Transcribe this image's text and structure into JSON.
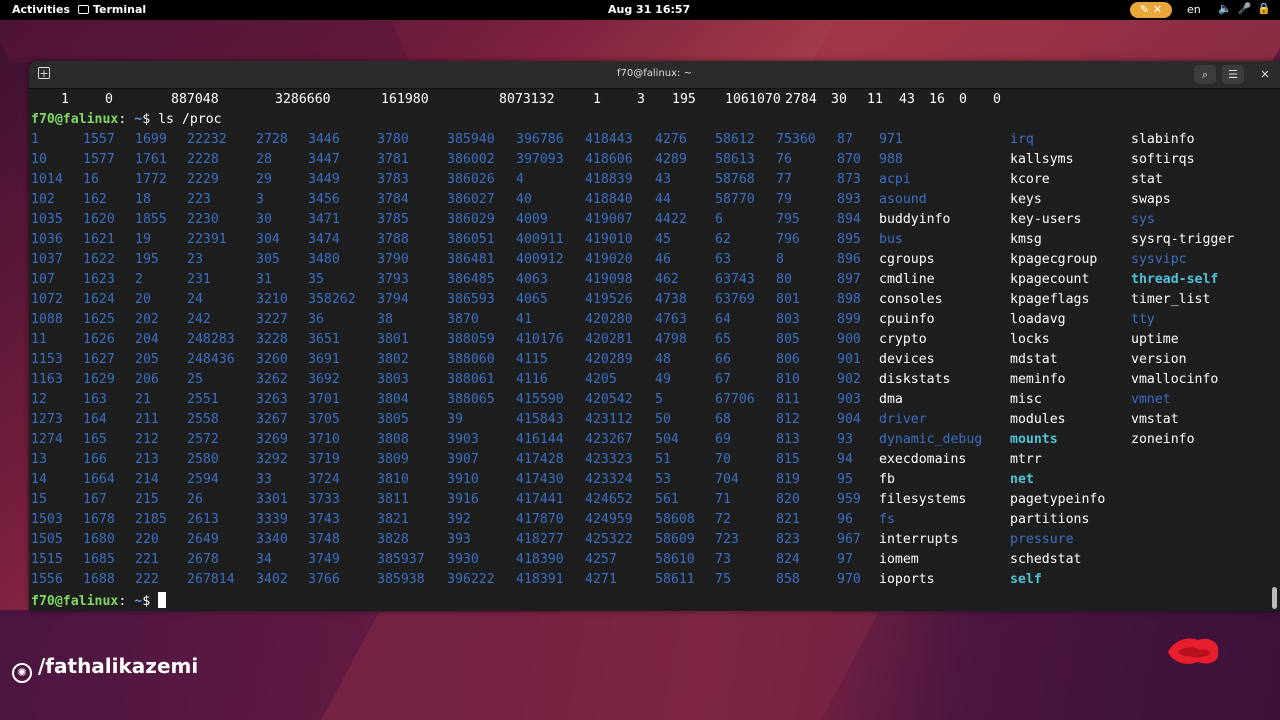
{
  "topbar": {
    "activities": "Activities",
    "app_name": "Terminal",
    "clock": "Aug 31  16:57",
    "indicator": "✎ ✕",
    "lang": "en",
    "tray": "🔈🎤🔒"
  },
  "window": {
    "title": "f70@falinux: ~"
  },
  "terminal": {
    "prev_line": [
      "1",
      "0",
      "887048",
      "3286660",
      "161980",
      "8073132",
      "1",
      "3",
      "195",
      "106",
      "1070",
      "2784",
      "30",
      "11",
      "43",
      "16",
      "0",
      "0"
    ],
    "prompt_user": "f70@falinux",
    "prompt_sep": ":",
    "prompt_path": " ~",
    "prompt_dollar": "$ ",
    "command": "ls /proc",
    "columns": [
      {
        "type": "dir",
        "items": [
          "1",
          "10",
          "1014",
          "102",
          "1035",
          "1036",
          "1037",
          "107",
          "1072",
          "1088",
          "11",
          "1153",
          "1163",
          "12",
          "1273",
          "1274",
          "13",
          "14",
          "15",
          "1503",
          "1505",
          "1515",
          "1556"
        ]
      },
      {
        "type": "dir",
        "items": [
          "1557",
          "1577",
          "16",
          "162",
          "1620",
          "1621",
          "1622",
          "1623",
          "1624",
          "1625",
          "1626",
          "1627",
          "1629",
          "163",
          "164",
          "165",
          "166",
          "1664",
          "167",
          "1678",
          "1680",
          "1685",
          "1688"
        ]
      },
      {
        "type": "dir",
        "items": [
          "1699",
          "1761",
          "1772",
          "18",
          "1855",
          "19",
          "195",
          "2",
          "20",
          "202",
          "204",
          "205",
          "206",
          "21",
          "211",
          "212",
          "213",
          "214",
          "215",
          "2185",
          "220",
          "221",
          "222"
        ]
      },
      {
        "type": "dir",
        "items": [
          "22232",
          "2228",
          "2229",
          "223",
          "2230",
          "22391",
          "23",
          "231",
          "24",
          "242",
          "248283",
          "248436",
          "25",
          "2551",
          "2558",
          "2572",
          "2580",
          "2594",
          "26",
          "2613",
          "2649",
          "2678",
          "267814"
        ]
      },
      {
        "type": "dir",
        "items": [
          "2728",
          "28",
          "29",
          "3",
          "30",
          "304",
          "305",
          "31",
          "3210",
          "3227",
          "3228",
          "3260",
          "3262",
          "3263",
          "3267",
          "3269",
          "3292",
          "33",
          "3301",
          "3339",
          "3340",
          "34",
          "3402"
        ]
      },
      {
        "type": "dir",
        "items": [
          "3446",
          "3447",
          "3449",
          "3456",
          "3471",
          "3474",
          "3480",
          "35",
          "358262",
          "36",
          "3651",
          "3691",
          "3692",
          "3701",
          "3705",
          "3710",
          "3719",
          "3724",
          "3733",
          "3743",
          "3748",
          "3749",
          "3766"
        ]
      },
      {
        "type": "dir",
        "items": [
          "3780",
          "3781",
          "3783",
          "3784",
          "3785",
          "3788",
          "3790",
          "3793",
          "3794",
          "38",
          "3801",
          "3802",
          "3803",
          "3804",
          "3805",
          "3808",
          "3809",
          "3810",
          "3811",
          "3821",
          "3828",
          "385937",
          "385938"
        ]
      },
      {
        "type": "dir",
        "items": [
          "385940",
          "386002",
          "386026",
          "386027",
          "386029",
          "386051",
          "386481",
          "386485",
          "386593",
          "3870",
          "388059",
          "388060",
          "388061",
          "388065",
          "39",
          "3903",
          "3907",
          "3910",
          "3916",
          "392",
          "393",
          "3930",
          "396222"
        ]
      },
      {
        "type": "dir",
        "items": [
          "396786",
          "397093",
          "4",
          "40",
          "4009",
          "400911",
          "400912",
          "4063",
          "4065",
          "41",
          "410176",
          "4115",
          "4116",
          "415590",
          "415843",
          "416144",
          "417428",
          "417430",
          "417441",
          "417870",
          "418277",
          "418390",
          "418391"
        ]
      },
      {
        "type": "dir",
        "items": [
          "418443",
          "418606",
          "418839",
          "418840",
          "419007",
          "419010",
          "419020",
          "419098",
          "419526",
          "420280",
          "420281",
          "420289",
          "4205",
          "420542",
          "423112",
          "423267",
          "423323",
          "423324",
          "424652",
          "424959",
          "425322",
          "4257",
          "4271"
        ]
      },
      {
        "type": "dir",
        "items": [
          "4276",
          "4289",
          "43",
          "44",
          "4422",
          "45",
          "46",
          "462",
          "4738",
          "4763",
          "4798",
          "48",
          "49",
          "5",
          "50",
          "504",
          "51",
          "53",
          "561",
          "58608",
          "58609",
          "58610",
          "58611"
        ]
      },
      {
        "type": "dir",
        "items": [
          "58612",
          "58613",
          "58768",
          "58770",
          "6",
          "62",
          "63",
          "63743",
          "63769",
          "64",
          "65",
          "66",
          "67",
          "67706",
          "68",
          "69",
          "70",
          "704",
          "71",
          "72",
          "723",
          "73",
          "75"
        ]
      },
      {
        "type": "dir",
        "items": [
          "75360",
          "76",
          "77",
          "79",
          "795",
          "796",
          "8",
          "80",
          "801",
          "803",
          "805",
          "806",
          "810",
          "811",
          "812",
          "813",
          "815",
          "819",
          "820",
          "821",
          "823",
          "824",
          "858"
        ]
      },
      {
        "type": "dir",
        "items": [
          "87",
          "870",
          "873",
          "893",
          "894",
          "895",
          "896",
          "897",
          "898",
          "899",
          "900",
          "901",
          "902",
          "903",
          "904",
          "93",
          "94",
          "95",
          "959",
          "96",
          "967",
          "97",
          "970"
        ]
      },
      {
        "type": "mixed",
        "items": [
          {
            "t": "dir",
            "v": "971"
          },
          {
            "t": "dir",
            "v": "988"
          },
          {
            "t": "dir",
            "v": "acpi"
          },
          {
            "t": "dir",
            "v": "asound"
          },
          {
            "t": "reg",
            "v": "buddyinfo"
          },
          {
            "t": "dir",
            "v": "bus"
          },
          {
            "t": "reg",
            "v": "cgroups"
          },
          {
            "t": "reg",
            "v": "cmdline"
          },
          {
            "t": "reg",
            "v": "consoles"
          },
          {
            "t": "reg",
            "v": "cpuinfo"
          },
          {
            "t": "reg",
            "v": "crypto"
          },
          {
            "t": "reg",
            "v": "devices"
          },
          {
            "t": "reg",
            "v": "diskstats"
          },
          {
            "t": "reg",
            "v": "dma"
          },
          {
            "t": "dir",
            "v": "driver"
          },
          {
            "t": "dir",
            "v": "dynamic_debug"
          },
          {
            "t": "reg",
            "v": "execdomains"
          },
          {
            "t": "reg",
            "v": "fb"
          },
          {
            "t": "reg",
            "v": "filesystems"
          },
          {
            "t": "dir",
            "v": "fs"
          },
          {
            "t": "reg",
            "v": "interrupts"
          },
          {
            "t": "reg",
            "v": "iomem"
          },
          {
            "t": "reg",
            "v": "ioports"
          }
        ]
      },
      {
        "type": "mixed",
        "items": [
          {
            "t": "dir",
            "v": "irq"
          },
          {
            "t": "reg",
            "v": "kallsyms"
          },
          {
            "t": "reg",
            "v": "kcore"
          },
          {
            "t": "reg",
            "v": "keys"
          },
          {
            "t": "reg",
            "v": "key-users"
          },
          {
            "t": "reg",
            "v": "kmsg"
          },
          {
            "t": "reg",
            "v": "kpagecgroup"
          },
          {
            "t": "reg",
            "v": "kpagecount"
          },
          {
            "t": "reg",
            "v": "kpageflags"
          },
          {
            "t": "reg",
            "v": "loadavg"
          },
          {
            "t": "reg",
            "v": "locks"
          },
          {
            "t": "reg",
            "v": "mdstat"
          },
          {
            "t": "reg",
            "v": "meminfo"
          },
          {
            "t": "reg",
            "v": "misc"
          },
          {
            "t": "reg",
            "v": "modules"
          },
          {
            "t": "lnk",
            "v": "mounts"
          },
          {
            "t": "reg",
            "v": "mtrr"
          },
          {
            "t": "lnk",
            "v": "net"
          },
          {
            "t": "reg",
            "v": "pagetypeinfo"
          },
          {
            "t": "reg",
            "v": "partitions"
          },
          {
            "t": "dir",
            "v": "pressure"
          },
          {
            "t": "reg",
            "v": "schedstat"
          },
          {
            "t": "lnk",
            "v": "self"
          }
        ]
      },
      {
        "type": "mixed",
        "items": [
          {
            "t": "reg",
            "v": "slabinfo"
          },
          {
            "t": "reg",
            "v": "softirqs"
          },
          {
            "t": "reg",
            "v": "stat"
          },
          {
            "t": "reg",
            "v": "swaps"
          },
          {
            "t": "dir",
            "v": "sys"
          },
          {
            "t": "reg",
            "v": "sysrq-trigger"
          },
          {
            "t": "dir",
            "v": "sysvipc"
          },
          {
            "t": "lnk",
            "v": "thread-self"
          },
          {
            "t": "reg",
            "v": "timer_list"
          },
          {
            "t": "dir",
            "v": "tty"
          },
          {
            "t": "reg",
            "v": "uptime"
          },
          {
            "t": "reg",
            "v": "version"
          },
          {
            "t": "reg",
            "v": "vmallocinfo"
          },
          {
            "t": "dir",
            "v": "vmnet"
          },
          {
            "t": "reg",
            "v": "vmstat"
          },
          {
            "t": "reg",
            "v": "zoneinfo"
          }
        ]
      }
    ]
  },
  "watermark": {
    "text": "/fathalikazemi",
    "icon": "camera-aperture-icon"
  }
}
